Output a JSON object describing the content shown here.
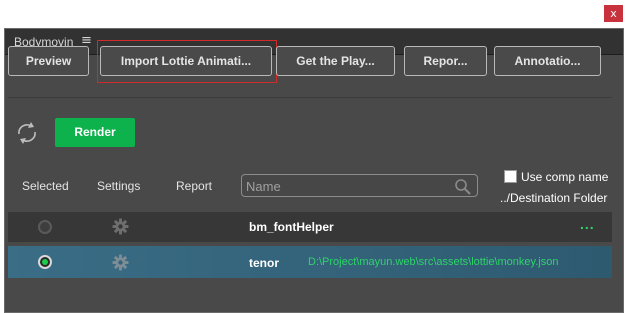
{
  "window": {
    "close_glyph": "x"
  },
  "panel": {
    "title": "Bodymovin",
    "menu_glyph": "≡"
  },
  "toolbar": {
    "buttons": [
      {
        "label": "Preview"
      },
      {
        "label": "Import Lottie Animati..."
      },
      {
        "label": "Get the Play..."
      },
      {
        "label": "Repor..."
      },
      {
        "label": "Annotatio..."
      }
    ]
  },
  "actions": {
    "refresh_icon": "refresh-icon",
    "render_label": "Render"
  },
  "columns": {
    "selected": "Selected",
    "settings": "Settings",
    "report": "Report"
  },
  "search": {
    "placeholder": "Name",
    "value": ""
  },
  "options": {
    "use_comp_name": "Use comp name",
    "use_comp_name_checked": false,
    "destination_folder": "../Destination Folder"
  },
  "compositions": [
    {
      "name": "bm_fontHelper",
      "selected": false,
      "destination": "",
      "more": "..."
    },
    {
      "name": "tenor",
      "selected": true,
      "destination": "D:\\Project\\mayun.web\\src\\assets\\lottie\\monkey.json"
    }
  ],
  "colors": {
    "accent_green": "#0eb24c",
    "path_green": "#2fd46a",
    "highlight_red": "#d02a2a",
    "selected_row": "#3a6d86"
  }
}
